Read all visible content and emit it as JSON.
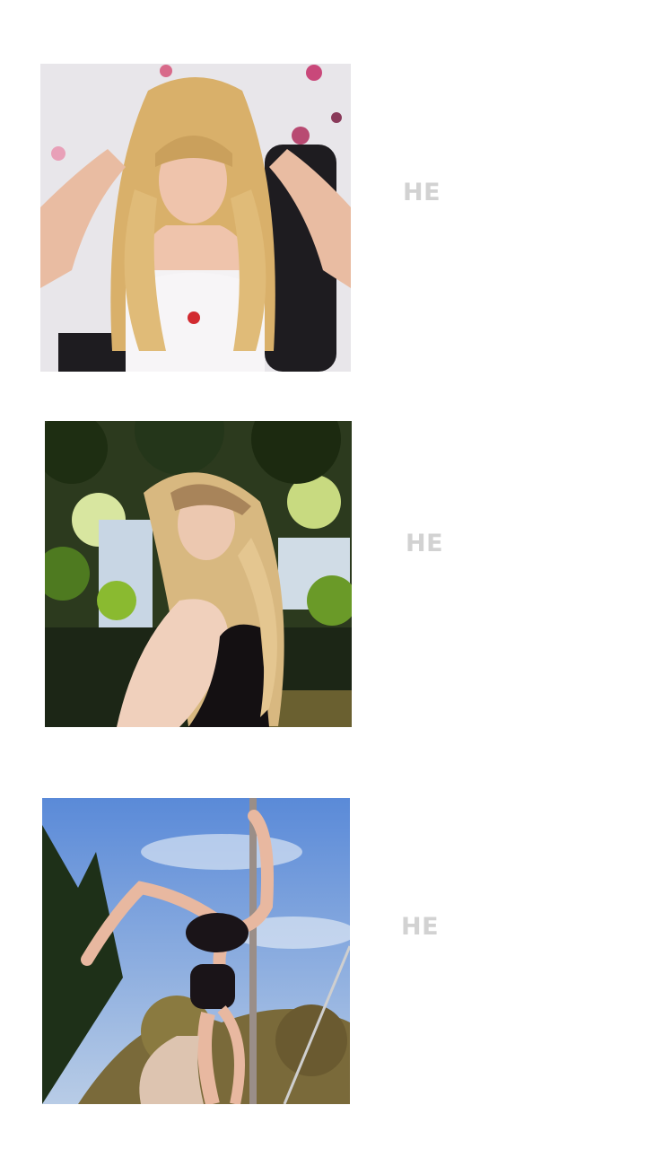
{
  "cards": [
    {
      "label": "HE",
      "image_icon": "photo-woman-blonde-white-top"
    },
    {
      "label": "HE",
      "image_icon": "photo-woman-blonde-garden"
    },
    {
      "label": "HE",
      "image_icon": "photo-woman-pole-dance-outdoor"
    }
  ],
  "colors": {
    "background": "#ffffff",
    "label": "#d2d2d2"
  }
}
